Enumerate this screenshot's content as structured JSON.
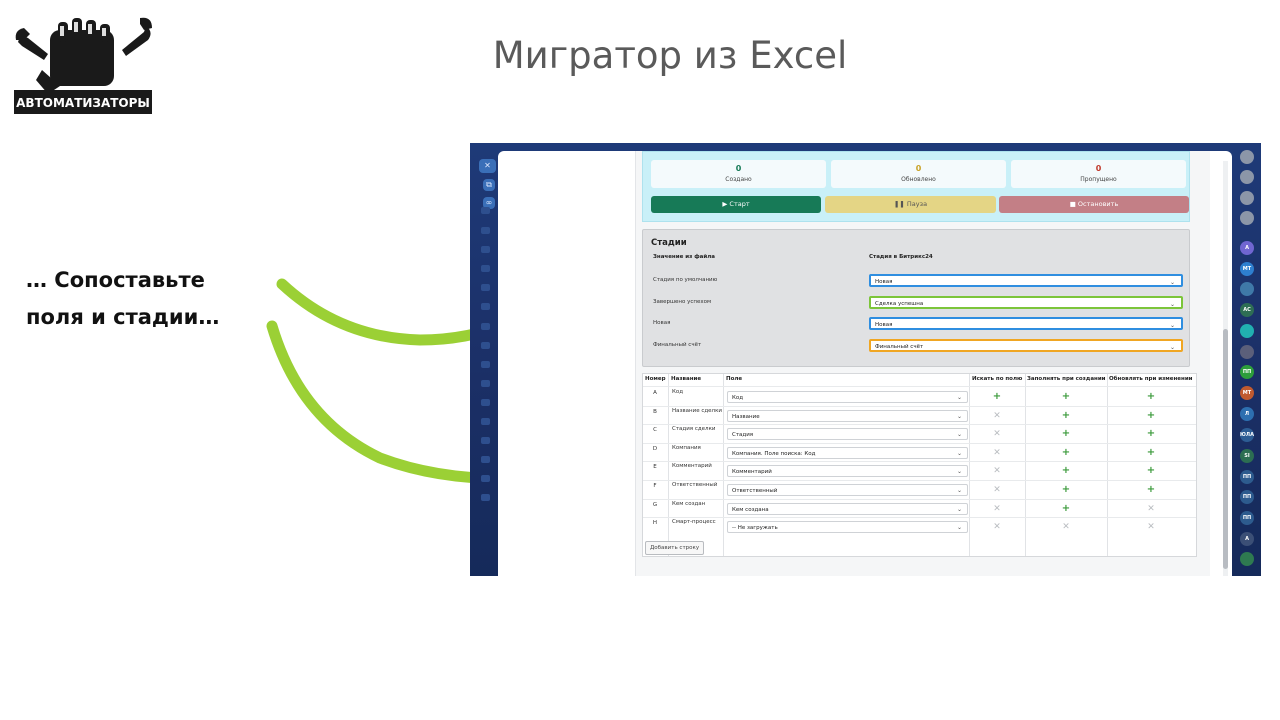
{
  "slide": {
    "title": "Мигратор из Excel",
    "caption": "… Сопоставьте поля и стадии…",
    "logo_text": "АВТОМАТИЗАТОРЫ",
    "arrow_color": "#9bd035"
  },
  "left_rail": {
    "close_icon": "close-icon",
    "items": [
      "external-link-icon",
      "link-icon",
      "folder-icon",
      "camera-icon",
      "chart-icon",
      "mail-icon",
      "briefcase-icon"
    ]
  },
  "right_rail": {
    "avatars": [
      {
        "text": "",
        "color": "#8c96a8"
      },
      {
        "text": "",
        "color": "#8c96a8"
      },
      {
        "text": "",
        "color": "#8c96a8"
      },
      {
        "text": "",
        "color": "#8c96a8"
      },
      {
        "text": "A",
        "color": "#7066d1"
      },
      {
        "text": "МТ",
        "color": "#2e7fcf"
      },
      {
        "text": "",
        "color": "#3f79a8"
      },
      {
        "text": "АС",
        "color": "#2e6e54"
      },
      {
        "text": "",
        "color": "#21b0b0"
      },
      {
        "text": "",
        "color": "#5b5f7a"
      },
      {
        "text": "ПП",
        "color": "#2d9e3b"
      },
      {
        "text": "МТ",
        "color": "#c05a2f"
      },
      {
        "text": "Л",
        "color": "#2d6fb0"
      },
      {
        "text": "ЮЛА",
        "color": "#2d5d94"
      },
      {
        "text": "SI",
        "color": "#2c6e52"
      },
      {
        "text": "ПП",
        "color": "#2d5b8e"
      },
      {
        "text": "ПП",
        "color": "#2d5b8e"
      },
      {
        "text": "ПП",
        "color": "#2d5b8e"
      },
      {
        "text": "A",
        "color": "#3b4f76"
      },
      {
        "text": "",
        "color": "#2e7a50"
      }
    ]
  },
  "stats": {
    "created": {
      "value": "0",
      "label": "Создано",
      "color": "#177a57"
    },
    "updated": {
      "value": "0",
      "label": "Обновлено",
      "color": "#c9a227"
    },
    "skipped": {
      "value": "0",
      "label": "Пропущено",
      "color": "#c0392b"
    },
    "buttons": {
      "start": "▶ Старт",
      "pause": "❚❚ Пауза",
      "stop": "■ Остановить"
    }
  },
  "stages": {
    "title": "Стадии",
    "col_from_file": "Значение из файла",
    "col_bitrix": "Стадия в Битрикс24",
    "rows": [
      {
        "from": "Стадия по умолчанию",
        "to": "Новая",
        "border": "#2f8ee0"
      },
      {
        "from": "Завершено успехом",
        "to": "Сделка успешна",
        "border": "#7cc53a"
      },
      {
        "from": "Новая",
        "to": "Новая",
        "border": "#2f8ee0"
      },
      {
        "from": "Финальный счёт",
        "to": "Финальный счёт",
        "border": "#f0a623"
      }
    ]
  },
  "fields": {
    "headers": {
      "num": "Номер",
      "name": "Название",
      "field": "Поле",
      "search": "Искать по полю",
      "fill": "Заполнять при создании",
      "update": "Обновлять при изменении"
    },
    "rows": [
      {
        "letter": "A",
        "name": "Код",
        "field": "Код",
        "search": "plus",
        "fill": "plus",
        "update": "plus"
      },
      {
        "letter": "B",
        "name": "Название сделки",
        "field": "Название",
        "search": "cross",
        "fill": "plus",
        "update": "plus"
      },
      {
        "letter": "C",
        "name": "Стадия сделки",
        "field": "Стадия",
        "search": "cross",
        "fill": "plus",
        "update": "plus"
      },
      {
        "letter": "D",
        "name": "Компания",
        "field": "Компания. Поле поиска: Код",
        "search": "cross",
        "fill": "plus",
        "update": "plus"
      },
      {
        "letter": "E",
        "name": "Комментарий",
        "field": "Комментарий",
        "search": "cross",
        "fill": "plus",
        "update": "plus"
      },
      {
        "letter": "F",
        "name": "Ответственный",
        "field": "Ответственный",
        "search": "cross",
        "fill": "plus",
        "update": "plus"
      },
      {
        "letter": "G",
        "name": "Кем создан",
        "field": "Кем создана",
        "search": "cross",
        "fill": "plus",
        "update": "cross"
      },
      {
        "letter": "H",
        "name": "Смарт-процесс",
        "field": "-- Не загружать",
        "search": "cross",
        "fill": "cross",
        "update": "cross"
      }
    ],
    "add_row": "Добавить строку"
  }
}
